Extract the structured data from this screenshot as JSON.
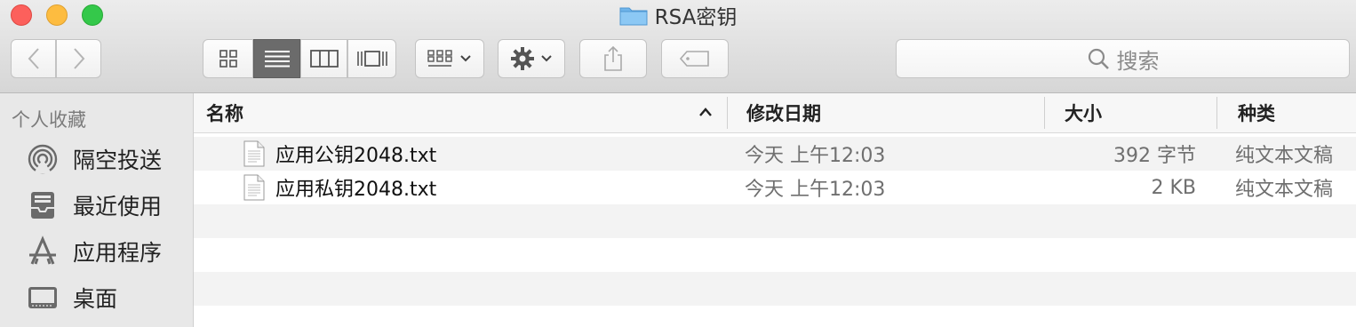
{
  "window": {
    "title": "RSA密钥"
  },
  "toolbar": {
    "search_placeholder": "搜索"
  },
  "sidebar": {
    "section_title": "个人收藏",
    "items": [
      {
        "label": "隔空投送",
        "icon": "airdrop-icon"
      },
      {
        "label": "最近使用",
        "icon": "recents-icon"
      },
      {
        "label": "应用程序",
        "icon": "applications-icon"
      },
      {
        "label": "桌面",
        "icon": "desktop-icon"
      }
    ]
  },
  "columns": {
    "name": "名称",
    "date": "修改日期",
    "size": "大小",
    "kind": "种类"
  },
  "files": [
    {
      "name": "应用公钥2048.txt",
      "date": "今天 上午12:03",
      "size": "392 字节",
      "kind": "纯文本文稿"
    },
    {
      "name": "应用私钥2048.txt",
      "date": "今天 上午12:03",
      "size": "2 KB",
      "kind": "纯文本文稿"
    }
  ],
  "colors": {
    "accent_folder": "#6fb4ea",
    "sidebar_bg": "#e8e8e8"
  }
}
